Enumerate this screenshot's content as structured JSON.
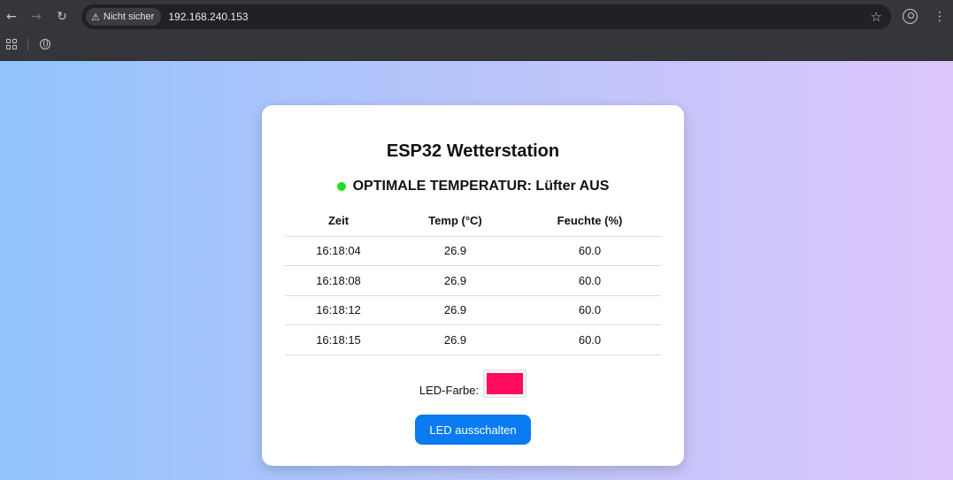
{
  "browser": {
    "security_label": "Nicht sicher",
    "url": "192.168.240.153"
  },
  "page": {
    "title": "ESP32 Wetterstation",
    "status": {
      "text": "OPTIMALE TEMPERATUR: Lüfter AUS",
      "indicator_color": "#22dd22"
    },
    "table": {
      "headers": [
        "Zeit",
        "Temp (°C)",
        "Feuchte (%)"
      ],
      "rows": [
        [
          "16:18:04",
          "26.9",
          "60.0"
        ],
        [
          "16:18:08",
          "26.9",
          "60.0"
        ],
        [
          "16:18:12",
          "26.9",
          "60.0"
        ],
        [
          "16:18:15",
          "26.9",
          "60.0"
        ]
      ]
    },
    "led": {
      "label": "LED-Farbe:",
      "color": "#ff0a5e",
      "button_label": "LED ausschalten"
    }
  }
}
